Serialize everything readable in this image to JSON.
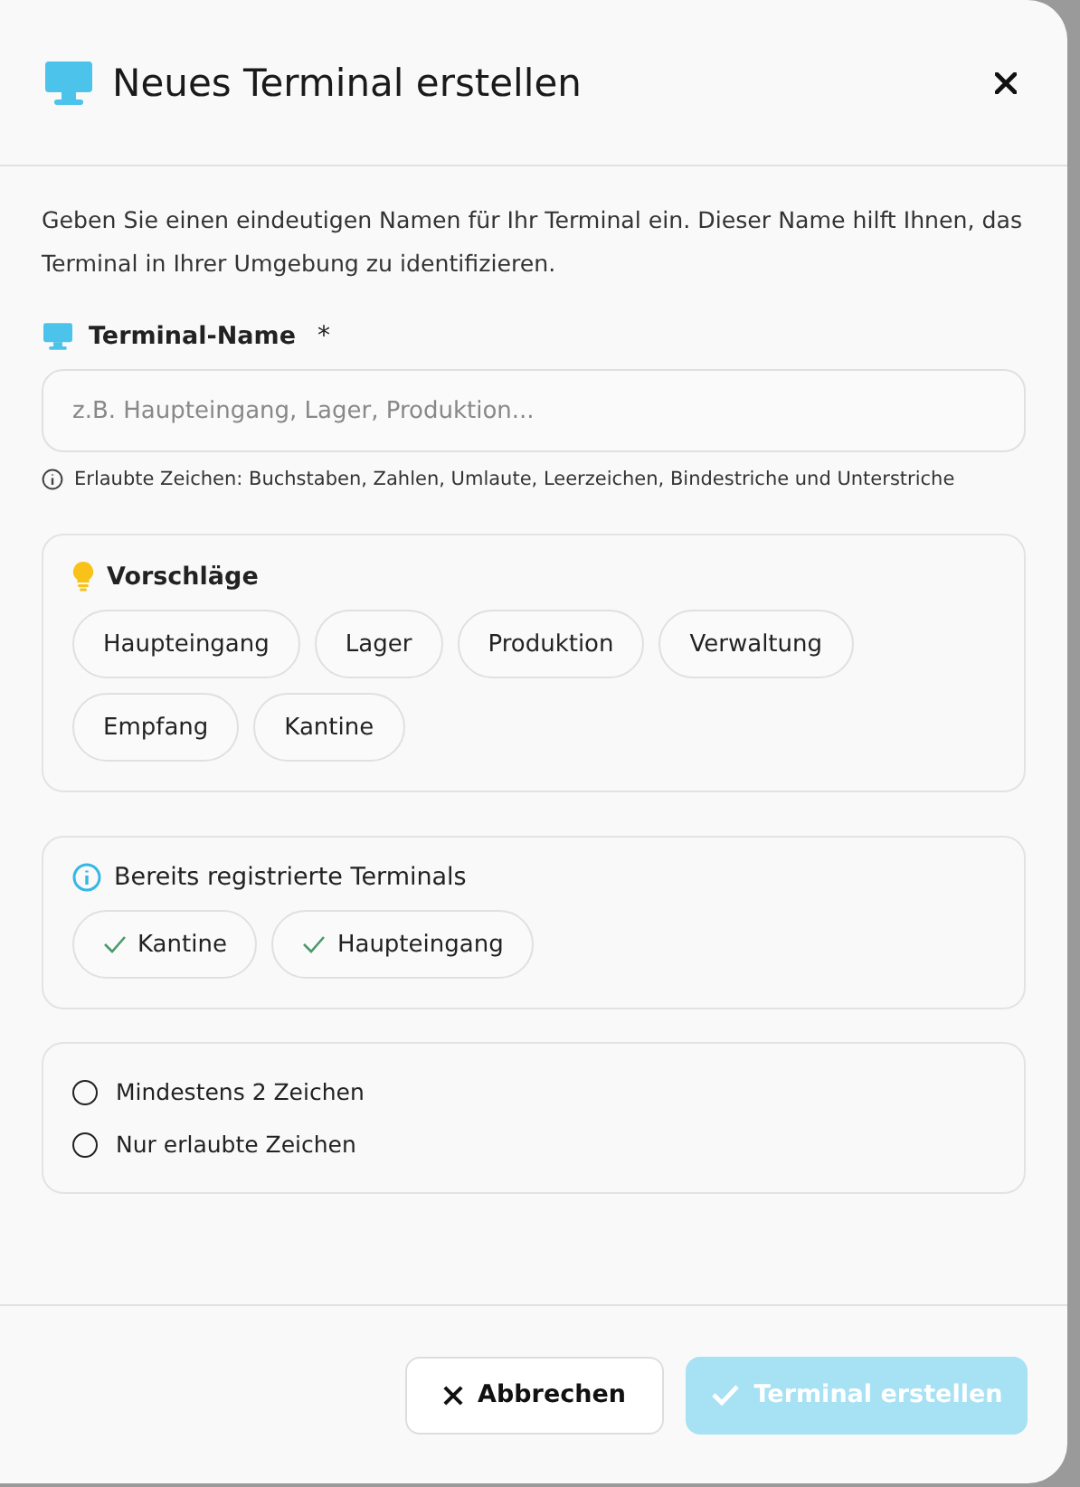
{
  "dialog": {
    "title": "Neues Terminal erstellen"
  },
  "description": "Geben Sie einen eindeutigen Namen für Ihr Terminal ein. Dieser Name hilft Ihnen, das Terminal in Ihrer Umgebung zu identifizieren.",
  "name_field": {
    "label": "Terminal-Name",
    "required_mark": "*",
    "placeholder": "z.B. Haupteingang, Lager, Produktion...",
    "hint": "Erlaubte Zeichen: Buchstaben, Zahlen, Umlaute, Leerzeichen, Bindestriche und Unterstriche"
  },
  "suggestions": {
    "title": "Vorschläge",
    "items": [
      "Haupteingang",
      "Lager",
      "Produktion",
      "Verwaltung",
      "Empfang",
      "Kantine"
    ]
  },
  "registered": {
    "title": "Bereits registrierte Terminals",
    "items": [
      "Kantine",
      "Haupteingang"
    ]
  },
  "rules": [
    {
      "label": "Mindestens 2 Zeichen",
      "checked": false
    },
    {
      "label": "Nur erlaubte Zeichen",
      "checked": false
    }
  ],
  "buttons": {
    "cancel": "Abbrechen",
    "submit": "Terminal erstellen",
    "submit_disabled": true
  }
}
